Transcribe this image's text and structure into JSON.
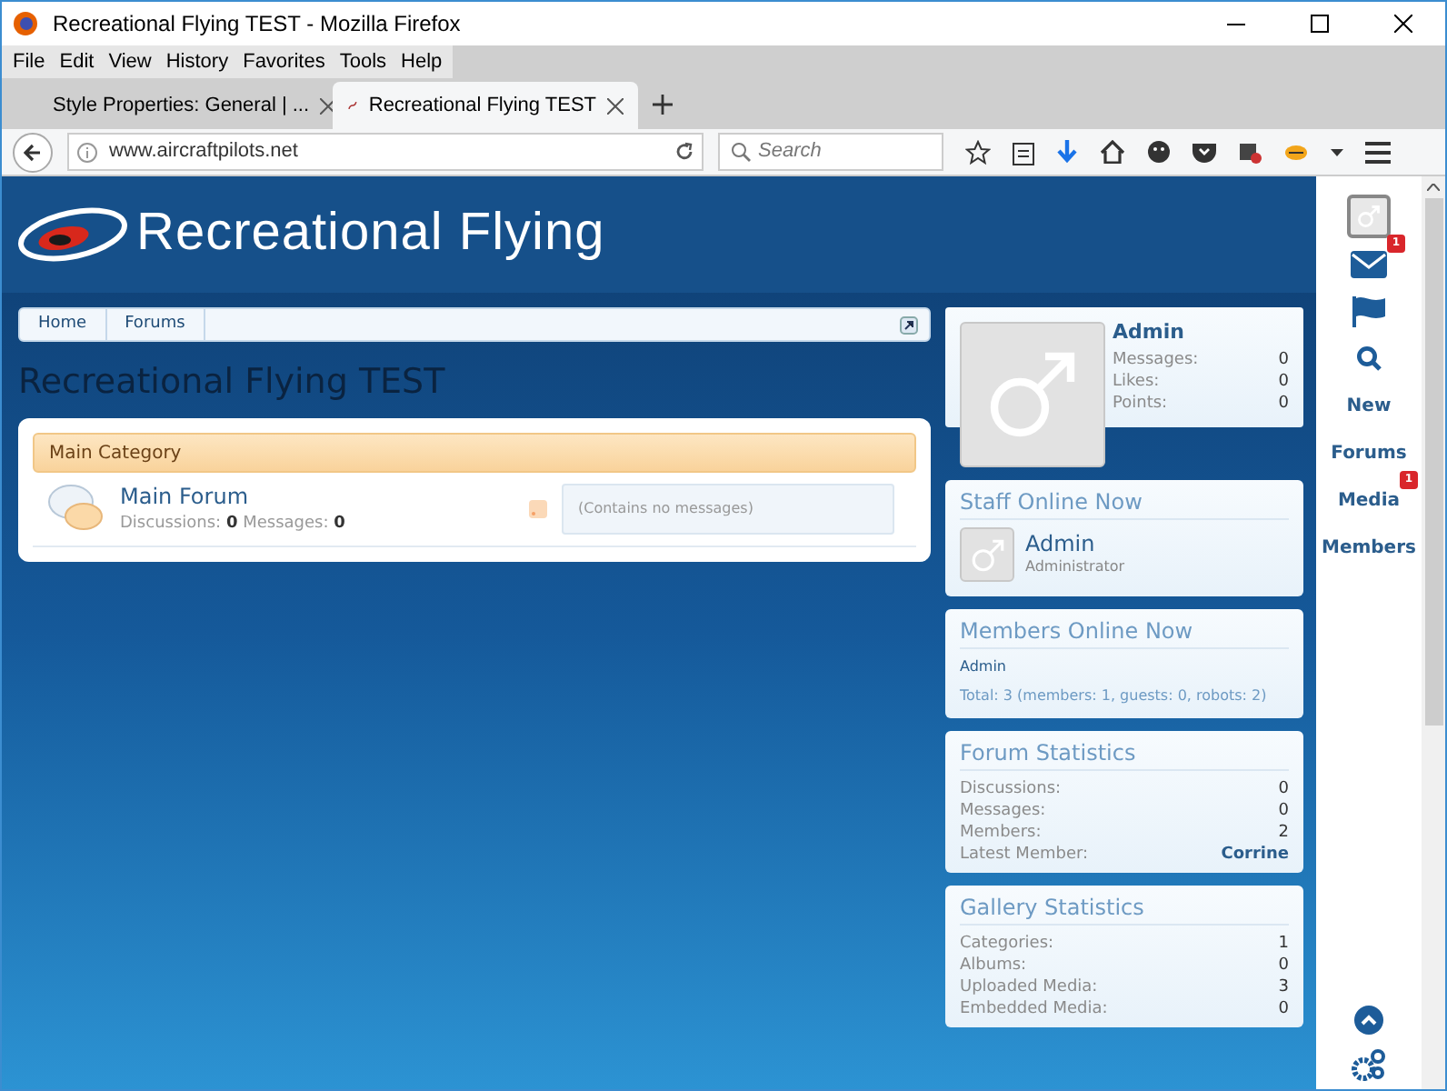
{
  "window": {
    "title": "Recreational Flying TEST - Mozilla Firefox"
  },
  "menu": [
    "File",
    "Edit",
    "View",
    "History",
    "Favorites",
    "Tools",
    "Help"
  ],
  "tabs": [
    {
      "label": "Style Properties: General | ...",
      "selected": false
    },
    {
      "label": "Recreational Flying TEST",
      "selected": true
    }
  ],
  "address": {
    "url": "www.aircraftpilots.net"
  },
  "search": {
    "placeholder": "Search"
  },
  "header": {
    "logo_text": "Recreational Flying"
  },
  "breadcrumb": [
    "Home",
    "Forums"
  ],
  "page_title": "Recreational Flying TEST",
  "category": {
    "title": "Main Category",
    "forums": [
      {
        "name": "Main Forum",
        "counts": "Discussions: **0** Messages: **0**",
        "last_post": "(Contains no messages)"
      }
    ]
  },
  "profile": {
    "name": "Admin",
    "stats": [
      {
        "label": "Messages:",
        "value": "0"
      },
      {
        "label": "Likes:",
        "value": "0"
      },
      {
        "label": "Points:",
        "value": "0"
      }
    ]
  },
  "staff_online": {
    "title": "Staff Online Now",
    "members": [
      {
        "name": "Admin",
        "role": "Administrator"
      }
    ]
  },
  "members_online": {
    "title": "Members Online Now",
    "names": [
      "Admin"
    ],
    "total": "Total: 3 (members: 1, guests: 0, robots: 2)"
  },
  "forum_statistics": {
    "title": "Forum Statistics",
    "rows": [
      {
        "label": "Discussions:",
        "value": "0",
        "link": false
      },
      {
        "label": "Messages:",
        "value": "0",
        "link": false
      },
      {
        "label": "Members:",
        "value": "2",
        "link": false
      },
      {
        "label": "Latest Member:",
        "value": "Corrine",
        "link": true
      }
    ]
  },
  "gallery_statistics": {
    "title": "Gallery Statistics",
    "rows": [
      {
        "label": "Categories:",
        "value": "1",
        "link": false
      },
      {
        "label": "Albums:",
        "value": "0",
        "link": false
      },
      {
        "label": "Uploaded Media:",
        "value": "3",
        "link": false
      },
      {
        "label": "Embedded Media:",
        "value": "0",
        "link": false
      }
    ]
  },
  "side_nav": [
    {
      "kind": "avatar"
    },
    {
      "kind": "mail",
      "badge": "1"
    },
    {
      "kind": "flag"
    },
    {
      "kind": "search"
    },
    {
      "kind": "link",
      "label": "New"
    },
    {
      "kind": "link",
      "label": "Forums"
    },
    {
      "kind": "link",
      "label": "Media",
      "badge": "1"
    },
    {
      "kind": "link",
      "label": "Members"
    }
  ]
}
